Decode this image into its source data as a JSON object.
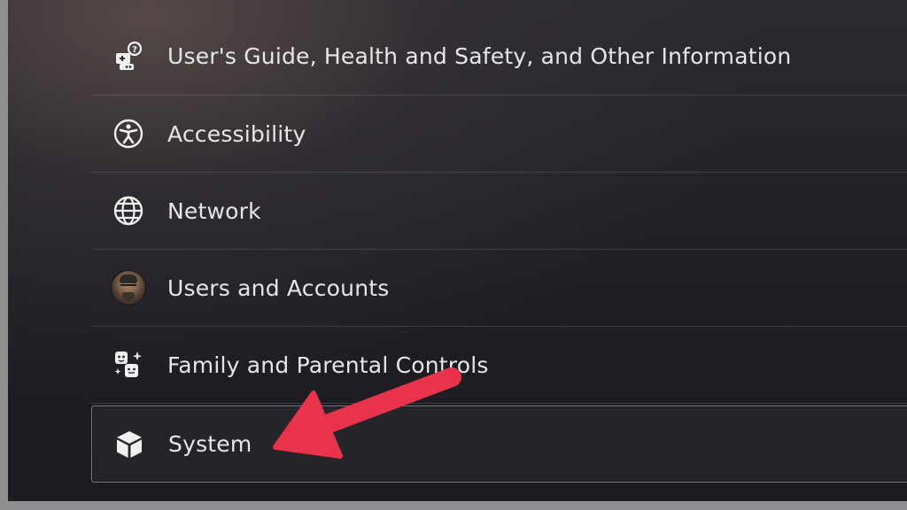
{
  "settings_menu": {
    "items": [
      {
        "label": "User's Guide, Health and Safety, and Other Information",
        "icon": "users-guide-icon"
      },
      {
        "label": "Accessibility",
        "icon": "accessibility-icon"
      },
      {
        "label": "Network",
        "icon": "globe-icon"
      },
      {
        "label": "Users and Accounts",
        "icon": "user-avatar"
      },
      {
        "label": "Family and Parental Controls",
        "icon": "family-icon"
      },
      {
        "label": "System",
        "icon": "cube-icon"
      }
    ],
    "selected_item": "System"
  },
  "annotation": {
    "type": "arrow",
    "color": "#e8334a",
    "points_to": "System"
  },
  "colors": {
    "text": "#e6e6e8",
    "background_dark": "#1e1e24",
    "frame": "#8f8f8f"
  }
}
